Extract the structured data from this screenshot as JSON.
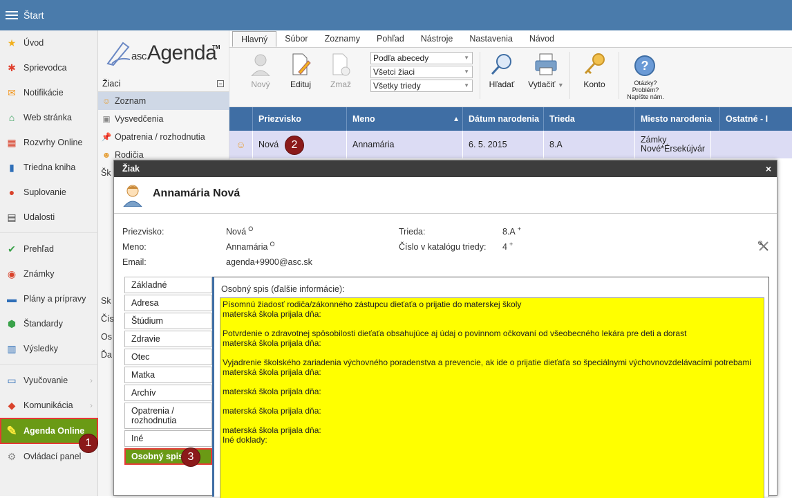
{
  "topbar": {
    "title": "Štart"
  },
  "leftnav": {
    "items": [
      {
        "label": "Úvod"
      },
      {
        "label": "Sprievodca"
      },
      {
        "label": "Notifikácie"
      },
      {
        "label": "Web stránka"
      },
      {
        "label": "Rozvrhy Online"
      },
      {
        "label": "Triedna kniha"
      },
      {
        "label": "Suplovanie"
      },
      {
        "label": "Udalosti"
      },
      {
        "label": "Prehľad"
      },
      {
        "label": "Známky"
      },
      {
        "label": "Plány a prípravy"
      },
      {
        "label": "Štandardy"
      },
      {
        "label": "Výsledky"
      },
      {
        "label": "Vyučovanie"
      },
      {
        "label": "Komunikácia"
      },
      {
        "label": "Agenda Online"
      },
      {
        "label": "Ovládací panel"
      }
    ]
  },
  "logo": {
    "prefix": "asc",
    "name": "Agenda",
    "tm": "TM"
  },
  "midcol": {
    "section": "Žiaci",
    "collapse": "−",
    "items": [
      {
        "label": "Zoznam"
      },
      {
        "label": "Vysvedčenia"
      },
      {
        "label": "Opatrenia / rozhodnutia"
      },
      {
        "label": "Rodičia"
      }
    ],
    "stubs": [
      "Šk",
      "Sk",
      "Čís",
      "Os",
      "Ďa"
    ]
  },
  "tabs": [
    "Hlavný",
    "Súbor",
    "Zoznamy",
    "Pohľad",
    "Nástroje",
    "Nastavenia",
    "Návod"
  ],
  "ribbon": {
    "new": "Nový",
    "edit": "Edituj",
    "delete": "Zmaž",
    "sort": "Podľa abecedy",
    "filter_students": "Všetci žiaci",
    "filter_classes": "Všetky triedy",
    "search": "Hľadať",
    "print": "Vytlačiť",
    "account": "Konto",
    "help_q": "Otázky?",
    "help_p": "Problém?",
    "help_w": "Napíšte nám."
  },
  "grid": {
    "headers": [
      "Priezvisko",
      "Meno",
      "Dátum narodenia",
      "Trieda",
      "Miesto narodenia",
      "Ostatné - I"
    ],
    "sort_indicator": "▲",
    "row": {
      "surname": "Nová",
      "name": "Annamária",
      "dob": "6. 5. 2015",
      "class": "8.A",
      "birthplace": "Zámky Nové*Érsekújvár",
      "other": ""
    }
  },
  "badges": [
    "1",
    "2",
    "3"
  ],
  "dialog": {
    "title": "Žiak",
    "close": "×",
    "student_name": "Annamária Nová",
    "fields": {
      "surname_label": "Priezvisko:",
      "surname_value": "Nová",
      "surname_mark": "O",
      "name_label": "Meno:",
      "name_value": "Annamária",
      "name_mark": "O",
      "email_label": "Email:",
      "email_value": "agenda+9900@asc.sk",
      "class_label": "Trieda:",
      "class_value": "8.A",
      "class_mark": "+",
      "catalog_label": "Číslo v katalógu triedy:",
      "catalog_value": "4",
      "catalog_mark": "+"
    },
    "side_tabs": [
      {
        "label": "Základné"
      },
      {
        "label": "Adresa"
      },
      {
        "label": "Štúdium"
      },
      {
        "label": "Zdravie"
      },
      {
        "label": "Otec"
      },
      {
        "label": "Matka"
      },
      {
        "label": "Archív"
      },
      {
        "label": "Opatrenia / rozhodnutia"
      },
      {
        "label": "Iné"
      },
      {
        "label": "Osobný spis"
      }
    ],
    "content_title": "Osobný spis (ďalšie informácie):",
    "content_text": "Písomnú žiadosť rodiča/zákonného zástupcu dieťaťa o prijatie do materskej školy\nmaterská škola prijala dňa:\n\nPotvrdenie o zdravotnej spôsobilosti dieťaťa obsahujúce aj údaj o povinnom očkovaní od všeobecného lekára pre deti a dorast\nmaterská škola prijala dňa:\n\nVyjadrenie školského zariadenia výchovného poradenstva a prevencie, ak ide o prijatie dieťaťa so špeciálnymi výchovnovzdelávacími potrebami\nmaterská škola prijala dňa:\n\nmaterská škola prijala dňa:\n\nmaterská škola prijala dňa:\n\nmaterská škola prijala dňa:\nIné doklady:"
  },
  "colors": {
    "topbar": "#4a7bab",
    "grid_header": "#3f6ea4",
    "selected_row": "#dcdcf4",
    "highlight_green": "#6a9a15",
    "highlight_border": "#e53935",
    "badge": "#8b1a1a",
    "yellow": "#ffff00"
  }
}
